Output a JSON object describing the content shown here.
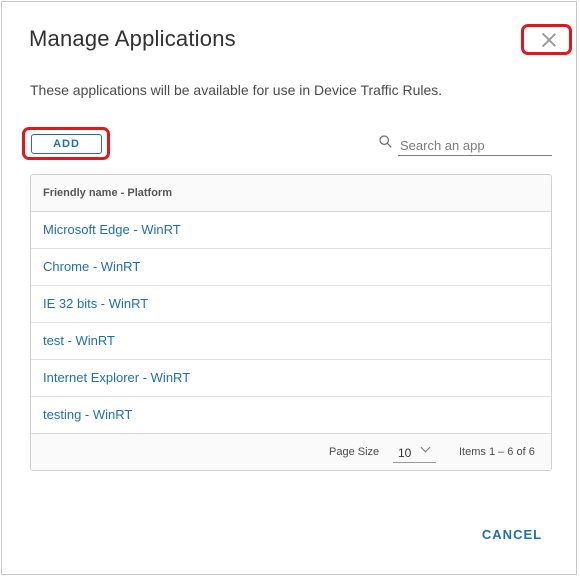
{
  "dialog": {
    "title": "Manage Applications",
    "description": "These applications will be available for use in Device Traffic Rules."
  },
  "toolbar": {
    "add_label": "ADD",
    "search_placeholder": "Search an app",
    "search_value": ""
  },
  "table": {
    "column_header": "Friendly name - Platform",
    "rows": [
      {
        "label": "Microsoft Edge - WinRT"
      },
      {
        "label": "Chrome - WinRT"
      },
      {
        "label": "IE 32 bits - WinRT"
      },
      {
        "label": "test - WinRT"
      },
      {
        "label": "Internet Explorer - WinRT"
      },
      {
        "label": "testing - WinRT"
      }
    ]
  },
  "footer": {
    "page_size_label": "Page Size",
    "page_size_value": "10",
    "items_count": "Items 1 – 6 of 6"
  },
  "actions": {
    "cancel_label": "CANCEL"
  },
  "colors": {
    "accent": "#1f6fb0",
    "highlight": "#e3161b"
  },
  "icons": {
    "close": "close-icon",
    "search": "search-icon",
    "dropdown": "chevron-down-icon"
  }
}
